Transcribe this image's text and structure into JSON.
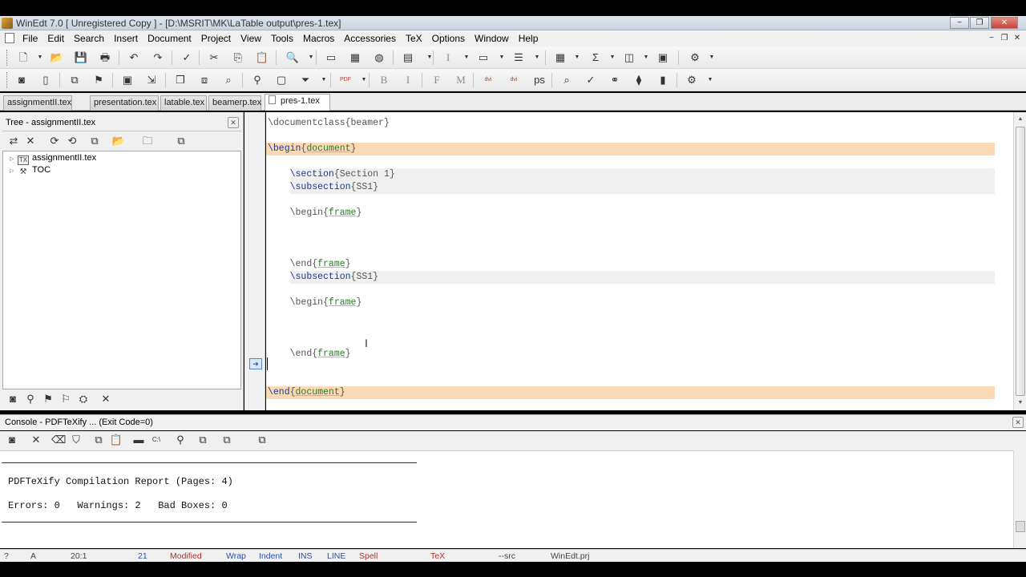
{
  "window": {
    "title": "WinEdt 7.0  [ Unregistered  Copy ] - [D:\\MSRIT\\MK\\LaTable output\\pres-1.tex]",
    "controls": [
      "−",
      "❐",
      "✕"
    ]
  },
  "menu": {
    "items": [
      "File",
      "Edit",
      "Search",
      "Insert",
      "Document",
      "Project",
      "View",
      "Tools",
      "Macros",
      "Accessories",
      "TeX",
      "Options",
      "Window",
      "Help"
    ],
    "mdi_controls": [
      "−",
      "❐",
      "✕"
    ]
  },
  "toolbar1": {
    "icons": [
      "new-icon",
      "open-icon",
      "save-icon",
      "print-icon",
      "undo-icon",
      "redo-icon",
      "spellcheck-icon",
      "cut-icon",
      "copy-icon",
      "paste-icon",
      "find-icon",
      "image-icon",
      "table-icon",
      "globe-icon",
      "document-icon",
      "italic-icon",
      "list-icon",
      "bullets-icon",
      "grid-icon",
      "sum-icon",
      "math-icon",
      "env-icon",
      "macro-icon"
    ],
    "glyphs": [
      "🗋",
      "📂",
      "💾",
      "🖶",
      "↶",
      "↷",
      "✓",
      "✂",
      "⎘",
      "📋",
      "🔍",
      "▭",
      "▦",
      "◍",
      "▤",
      "I",
      "▭",
      "☰",
      "▦",
      "Σ",
      "◫",
      "▣",
      "⚙"
    ]
  },
  "toolbar2": {
    "icons": [
      "bookmark-icon",
      "page-icon",
      "tree-icon",
      "hierarchy-icon",
      "console-icon",
      "export-icon",
      "cube-icon",
      "layers-icon",
      "zoom-icon",
      "run-icon",
      "window-icon",
      "filter-icon",
      "pdf-compile-icon",
      "bold-icon",
      "italic-text-icon",
      "font-f-icon",
      "font-m-icon",
      "dvi-pdf-icon",
      "dvi-ps-icon",
      "ps-pdf-icon",
      "search-tex-icon",
      "view-icon",
      "bibtex-icon",
      "acrobat-icon",
      "pdf-icon",
      "settings-icon"
    ],
    "glyphs": [
      "◙",
      "▯",
      "⧉",
      "⚑",
      "▣",
      "⇲",
      "❒",
      "⧈",
      "⌕",
      "⚲",
      "▢",
      "⏷",
      "PDF",
      "B",
      "I",
      "F",
      "M",
      "dvi",
      "dvi",
      "ps",
      "⌕",
      "✓",
      "⚭",
      "⧫",
      "▮",
      "⚙"
    ]
  },
  "tabs": [
    "assignmentII.tex",
    "presentation.tex",
    "latable.tex",
    "beamerp.tex",
    "pres-1.tex"
  ],
  "tree": {
    "title": "Tree - assignmentII.tex",
    "items": [
      {
        "label": "assignmentII.tex",
        "icon": "tex-file-icon",
        "glyph": "TX"
      },
      {
        "label": "TOC",
        "icon": "toc-icon",
        "glyph": "⚒"
      }
    ],
    "tool_glyphs": [
      "⇄",
      "✕",
      "⟳",
      "⟲",
      "⧉",
      "📂",
      "🗀",
      "⧉"
    ],
    "bottom_glyphs": [
      "◙",
      "⚲",
      "⚑",
      "⚐",
      "⛭",
      "✕"
    ]
  },
  "editor": {
    "lines": [
      {
        "indent": "",
        "cmd": "\\documentclass",
        "arg": "beamer",
        "hl": "none",
        "argstyle": "plain"
      },
      {
        "indent": "",
        "cmd": "\\begin",
        "arg": "document",
        "hl": "orange",
        "argstyle": "arg"
      },
      {
        "indent": "    ",
        "cmd": "\\section",
        "arg": "Section 1",
        "hl": "gray",
        "argstyle": "plain"
      },
      {
        "indent": "    ",
        "cmd": "\\subsection",
        "arg": "SS1",
        "hl": "gray",
        "argstyle": "plain"
      },
      {
        "indent": "    ",
        "cmd": "\\begin",
        "arg": "frame",
        "hl": "none",
        "argstyle": "arg"
      },
      {
        "indent": "    ",
        "cmd": "\\end",
        "arg": "frame",
        "hl": "none",
        "argstyle": "arg"
      },
      {
        "indent": "    ",
        "cmd": "\\subsection",
        "arg": "SS1",
        "hl": "gray",
        "argstyle": "plain"
      },
      {
        "indent": "    ",
        "cmd": "\\begin",
        "arg": "frame",
        "hl": "none",
        "argstyle": "arg"
      },
      {
        "indent": "    ",
        "cmd": "\\end",
        "arg": "frame",
        "hl": "none",
        "argstyle": "arg"
      },
      {
        "indent": "",
        "cmd": "\\end",
        "arg": "document",
        "hl": "orange",
        "argstyle": "arg"
      }
    ]
  },
  "console": {
    "title": "Console - PDFTeXify ... (Exit Code=0)",
    "report": "PDFTeXify Compilation Report (Pages: 4)",
    "summary": "Errors: 0   Warnings: 2   Bad Boxes: 0",
    "tool_glyphs": [
      "◙",
      "✕",
      "⌫",
      "⛉",
      "⧉",
      "📋",
      "▬",
      "C:\\",
      "⚲",
      "⧉",
      "⧉",
      "⧉"
    ]
  },
  "status": {
    "help": "?",
    "mode": "A",
    "position": "20:1",
    "lines": "21",
    "modified": "Modified",
    "wrap": "Wrap",
    "indent": "Indent",
    "ins": "INS",
    "line": "LINE",
    "spell": "Spell",
    "tex": "TeX",
    "src": "--src",
    "project": "WinEdt.prj"
  },
  "colors": {
    "highlight_orange": "#fcd9b5",
    "highlight_gray": "#efefef",
    "command": "#1b3a8c",
    "argument": "#2c7a2c"
  }
}
